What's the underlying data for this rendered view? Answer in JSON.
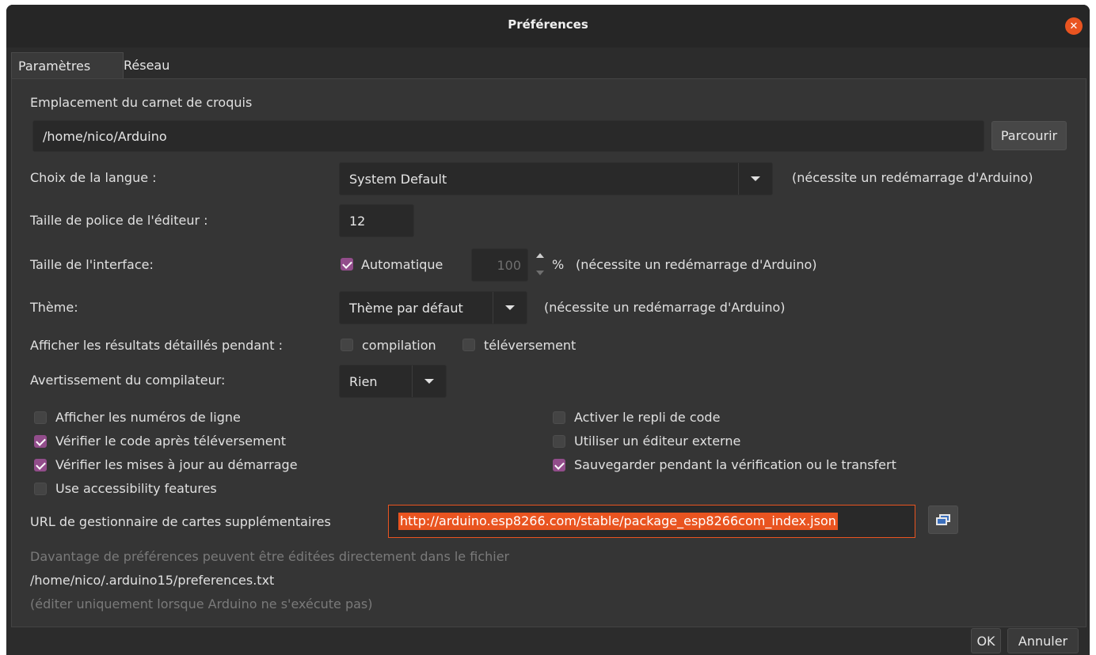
{
  "window": {
    "title": "Préférences"
  },
  "tabs": [
    {
      "label": "Paramètres"
    },
    {
      "label": "Réseau"
    }
  ],
  "sketchbook": {
    "label": "Emplacement du carnet de croquis",
    "path": "/home/nico/Arduino",
    "browse_label": "Parcourir"
  },
  "language": {
    "label": "Choix de la langue :",
    "value": "System Default",
    "note": "(nécessite un redémarrage d'Arduino)"
  },
  "font_size": {
    "label": "Taille de police de l'éditeur :",
    "value": "12"
  },
  "interface_size": {
    "label": "Taille de l'interface:",
    "auto_label": "Automatique",
    "auto_checked": true,
    "value": "100",
    "unit": "%",
    "note": "(nécessite un redémarrage d'Arduino)"
  },
  "theme": {
    "label": "Thème:",
    "value": "Thème par défaut",
    "note": "(nécessite un redémarrage d'Arduino)"
  },
  "verbose": {
    "label": "Afficher les résultats détaillés pendant :",
    "compile_label": "compilation",
    "upload_label": "téléversement"
  },
  "warnings": {
    "label": "Avertissement du compilateur:",
    "value": "Rien"
  },
  "options_left": [
    {
      "label": "Afficher les numéros de ligne",
      "checked": false
    },
    {
      "label": "Vérifier le code après téléversement",
      "checked": true
    },
    {
      "label": "Vérifier les mises à jour au démarrage",
      "checked": true
    },
    {
      "label": "Use accessibility features",
      "checked": false
    }
  ],
  "options_right": [
    {
      "label": "Activer le repli de code",
      "checked": false
    },
    {
      "label": "Utiliser un éditeur externe",
      "checked": false
    },
    {
      "label": "Sauvegarder pendant la vérification ou le transfert",
      "checked": true
    }
  ],
  "boards_url": {
    "label": "URL de gestionnaire de cartes supplémentaires",
    "value": "http://arduino.esp8266.com/stable/package_esp8266com_index.json"
  },
  "footer_note": {
    "line1": "Davantage de préférences peuvent être éditées directement dans le fichier",
    "path": "/home/nico/.arduino15/preferences.txt",
    "line3": "(éditer uniquement lorsque Arduino ne s'exécute pas)"
  },
  "buttons": {
    "ok": "OK",
    "cancel": "Annuler"
  },
  "colors": {
    "accent": "#e95420",
    "check": "#924d8b",
    "background": "#2c2c2c"
  }
}
